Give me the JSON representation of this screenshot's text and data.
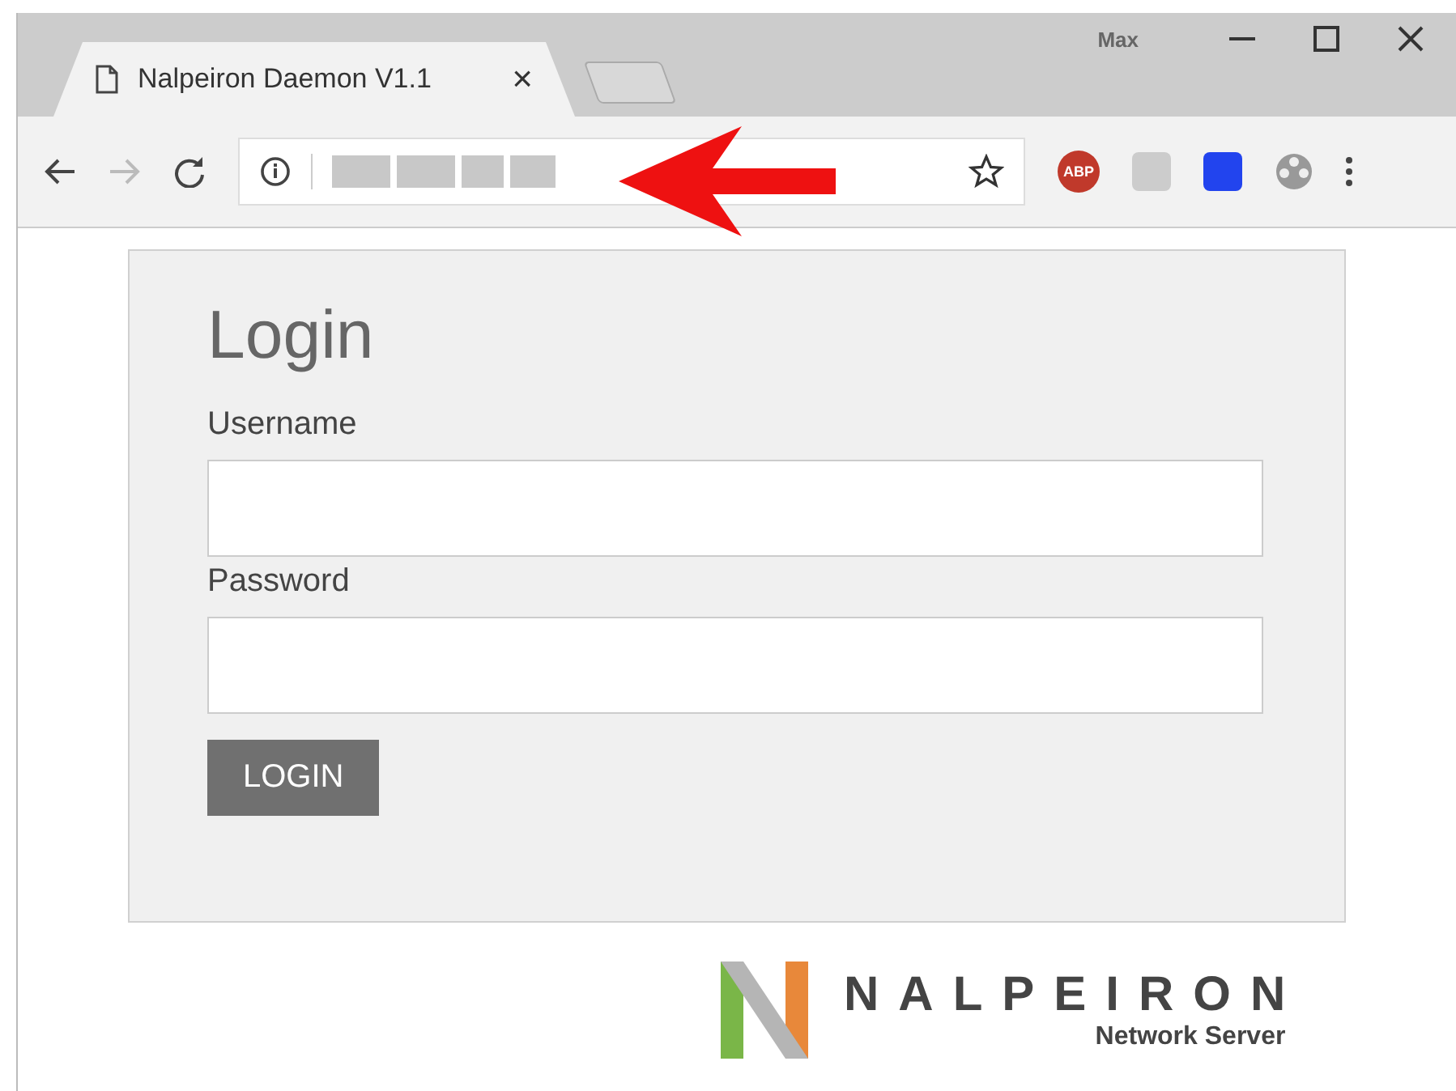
{
  "browser": {
    "profile": "Max",
    "tabs": [
      {
        "title": "Nalpeiron Daemon V1.1",
        "close": "×",
        "selected": true
      }
    ],
    "extensions": [
      {
        "label": "ABP"
      }
    ]
  },
  "login": {
    "title": "Login",
    "fields": [
      {
        "label": "Username"
      },
      {
        "label": "Password"
      }
    ],
    "button": "LOGIN"
  },
  "logo": {
    "name": "NALPEIRON",
    "subtitle": "Network Server"
  }
}
